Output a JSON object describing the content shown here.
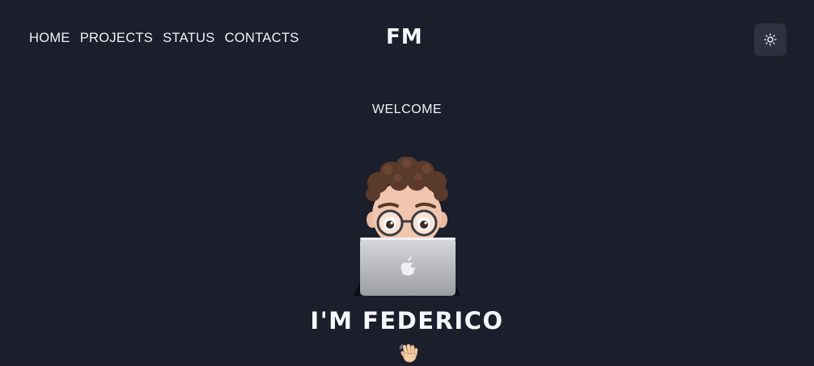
{
  "nav": {
    "items": [
      {
        "label": "HOME"
      },
      {
        "label": "PROJECTS"
      },
      {
        "label": "STATUS"
      },
      {
        "label": "CONTACTS"
      }
    ]
  },
  "header": {
    "logo_text": "FM",
    "theme_toggle_icon": "sun-icon"
  },
  "hero": {
    "welcome": "WELCOME",
    "avatar_icon": "memoji-avatar-with-laptop",
    "headline": "I'M FEDERICO",
    "emoji_icon": "waving-hand-icon"
  },
  "colors": {
    "background": "#1b1e2b",
    "text": "#f2f3f7",
    "toggle_bg": "#2d3140"
  }
}
